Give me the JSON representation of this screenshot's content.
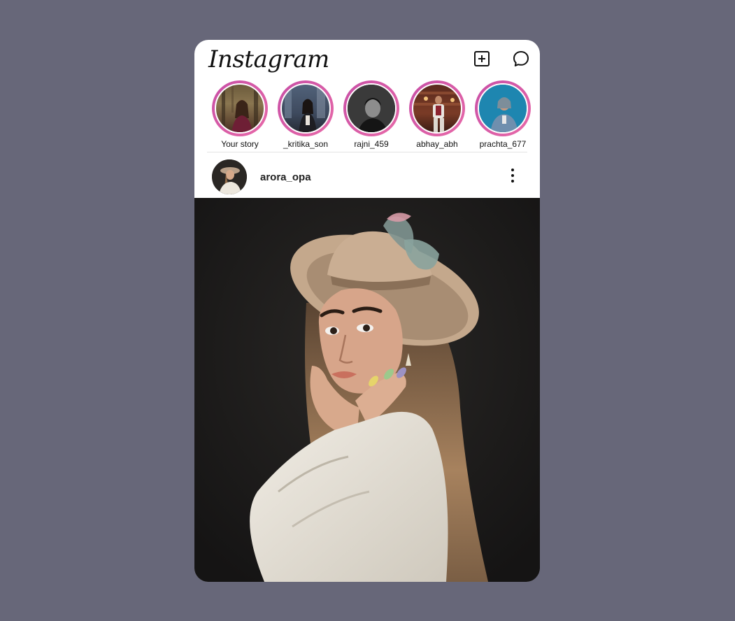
{
  "header": {
    "logo": "Instagram",
    "icons": [
      "add-post-icon",
      "messenger-icon"
    ]
  },
  "stories": [
    {
      "label": "Your story"
    },
    {
      "label": "_kritika_son"
    },
    {
      "label": "rajni_459"
    },
    {
      "label": "abhay_abh"
    },
    {
      "label": "prachta_677"
    }
  ],
  "post": {
    "username": "arora_opa",
    "menu_icon": "more-vertical-icon"
  },
  "colors": {
    "background": "#676779",
    "story_ring": "#d95ca8",
    "card": "#ffffff"
  }
}
